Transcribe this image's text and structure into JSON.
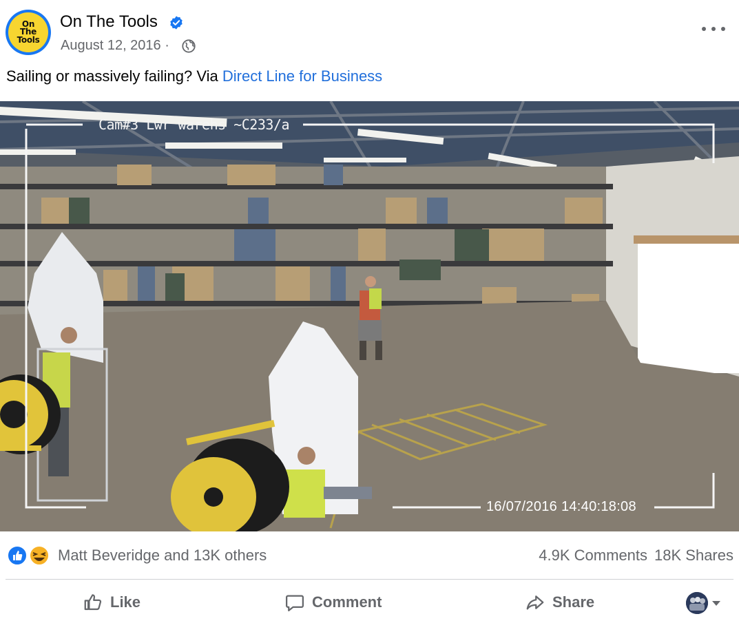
{
  "post": {
    "author": "On The Tools",
    "avatar_text": [
      "On",
      "The",
      "Tools"
    ],
    "date": "August 12, 2016 ·",
    "caption_text": "Sailing or massively failing? Via ",
    "caption_link": "Direct Line for Business"
  },
  "video": {
    "overlay_camera": "Cam#3 Lwr warehs ~C233/a",
    "overlay_timestamp": "16/07/2016 14:40:18:08"
  },
  "stats": {
    "reactors": "Matt Beveridge and 13K others",
    "comments": "4.9K Comments",
    "shares": "18K Shares"
  },
  "actions": {
    "like": "Like",
    "comment": "Comment",
    "share": "Share"
  },
  "icons": {
    "verified": "verified-badge-icon",
    "audience": "globe-icon",
    "more": "more-options-icon",
    "like_reaction": "like-reaction-icon",
    "haha_reaction": "haha-reaction-icon"
  },
  "colors": {
    "brand_blue": "#1877f2",
    "link": "#216fdb",
    "muted": "#65676b",
    "avatar_yellow": "#f7d530"
  }
}
